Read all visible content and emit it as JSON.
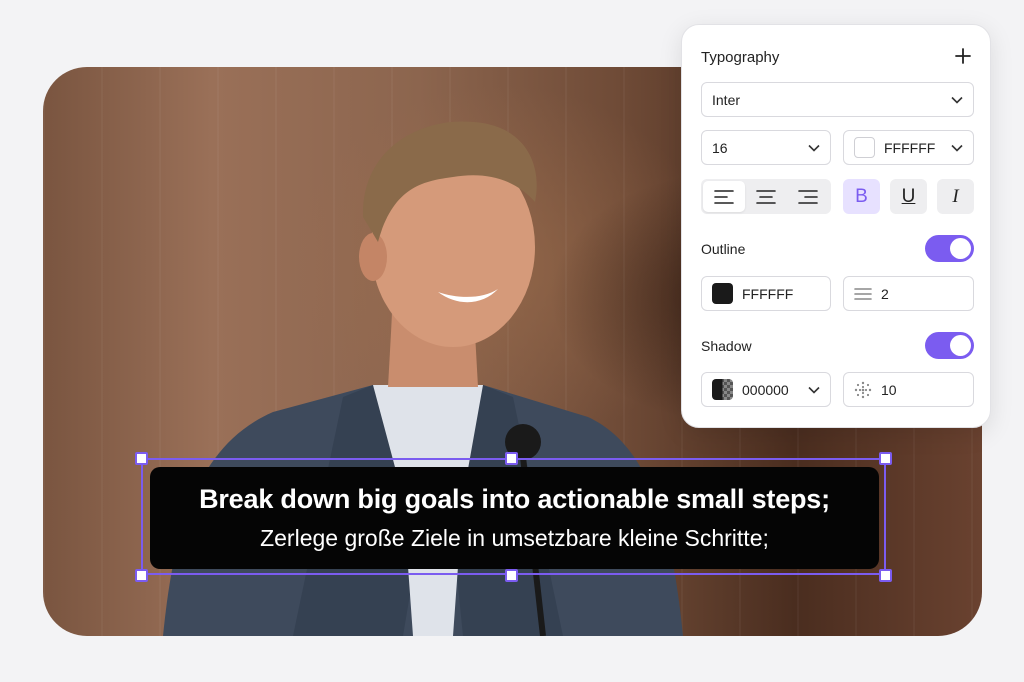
{
  "subtitle": {
    "primary": "Break down big goals into actionable small steps;",
    "secondary": "Zerlege große Ziele in umsetzbare kleine Schritte;"
  },
  "panel": {
    "title": "Typography",
    "font_family": "Inter",
    "font_size": "16",
    "text_color": "FFFFFF",
    "alignment": "left",
    "bold_label": "B",
    "underline_label": "U",
    "italic_label": "I",
    "outline": {
      "label": "Outline",
      "enabled": true,
      "color": "FFFFFF",
      "width": "2"
    },
    "shadow": {
      "label": "Shadow",
      "enabled": true,
      "color": "000000",
      "blur": "10"
    }
  },
  "colors": {
    "accent": "#7b5cf0",
    "subtitle_bg": "#050505"
  },
  "icons": [
    "plus-icon",
    "chevron-down-icon",
    "align-left-icon",
    "align-center-icon",
    "align-right-icon",
    "line-weight-icon",
    "blur-icon"
  ]
}
